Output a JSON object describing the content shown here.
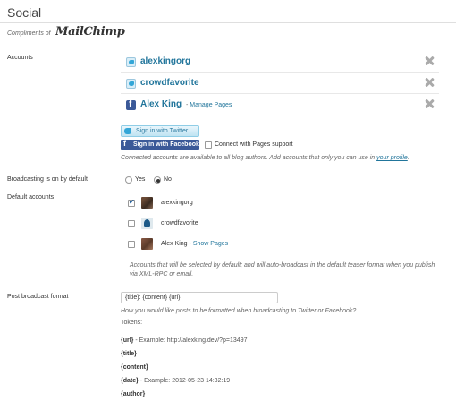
{
  "header": {
    "title": "Social",
    "compliments": "Compliments of",
    "brand": "MailChimp"
  },
  "accounts": {
    "label": "Accounts",
    "items": [
      {
        "name": "alexkingorg",
        "icon": "twitter-icon"
      },
      {
        "name": "crowdfavorite",
        "icon": "twitter-icon"
      },
      {
        "name": "Alex King",
        "icon": "facebook-icon",
        "extra_sep": "-",
        "extra": "Manage Pages"
      }
    ],
    "sign_in_twitter": "Sign in with Twitter",
    "sign_in_facebook": "Sign in with Facebook",
    "pages_support_label": "Connect with Pages support",
    "help_prefix": "Connected accounts are available to all blog authors. Add accounts that only you can use in",
    "help_link": "your profile",
    "help_suffix": "."
  },
  "broadcasting": {
    "label": "Broadcasting is on by default",
    "options": [
      "Yes",
      "No"
    ],
    "selected": "No"
  },
  "default_accounts": {
    "label": "Default accounts",
    "items": [
      {
        "name": "alexkingorg",
        "checked": true
      },
      {
        "name": "crowdfavorite",
        "checked": false
      },
      {
        "name": "Alex King",
        "checked": false,
        "extra_sep": "-",
        "extra": "Show Pages"
      }
    ],
    "help_line1": "Accounts that will be selected by default; and will auto-broadcast in the default teaser format when you publish",
    "help_line2": "via XML-RPC or email."
  },
  "format": {
    "label": "Post broadcast format",
    "value": "{title}: {content} {url}",
    "help": "How you would like posts to be formatted when broadcasting to Twitter or Facebook?",
    "tokens_label": "Tokens:",
    "tokens": [
      {
        "token": "{url}",
        "sep": " - Example: ",
        "example": "http://alexking.dev/?p=13497"
      },
      {
        "token": "{title}",
        "sep": "",
        "example": ""
      },
      {
        "token": "{content}",
        "sep": "",
        "example": ""
      },
      {
        "token": "{date}",
        "sep": " - Example: ",
        "example": "2012-05-23 14:32:19"
      },
      {
        "token": "{author}",
        "sep": "",
        "example": ""
      }
    ]
  },
  "colors": {
    "link": "#21759b",
    "facebook": "#3b5998",
    "twitter": "#33a6d7"
  }
}
